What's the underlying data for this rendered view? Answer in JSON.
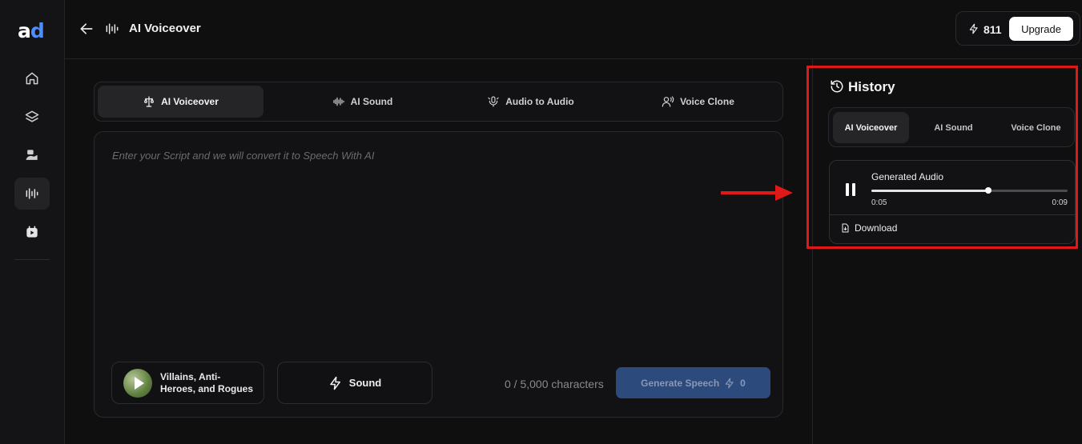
{
  "app": {
    "logo_a": "a",
    "logo_d": "d",
    "accent": "#4c8dff"
  },
  "sidebar": {
    "items": [
      {
        "name": "home",
        "icon": "home-icon",
        "active": false
      },
      {
        "name": "layers",
        "icon": "layers-icon",
        "active": false
      },
      {
        "name": "ai-avatar",
        "icon": "ai-avatar-icon",
        "active": false
      },
      {
        "name": "voice",
        "icon": "waveform-icon",
        "active": true
      },
      {
        "name": "media",
        "icon": "media-icon",
        "active": false
      }
    ]
  },
  "header": {
    "title": "AI Voiceover",
    "credits": "811",
    "upgrade_label": "Upgrade"
  },
  "main": {
    "tabs": [
      {
        "label": "AI Voiceover",
        "icon": "voiceover-icon",
        "active": true
      },
      {
        "label": "AI Sound",
        "icon": "sound-wave-icon",
        "active": false
      },
      {
        "label": "Audio to Audio",
        "icon": "audio-to-audio-icon",
        "active": false
      },
      {
        "label": "Voice Clone",
        "icon": "voice-clone-icon",
        "active": false
      }
    ],
    "script_placeholder": "Enter your Script and we will convert it to Speech With AI",
    "script_value": "",
    "voice_name": "Villains, Anti-Heroes, and Rogues",
    "sound_label": "Sound",
    "char_count": "0 / 5,000 characters",
    "generate_label": "Generate Speech",
    "generate_cost": "0"
  },
  "history": {
    "title": "History",
    "tabs": [
      {
        "label": "AI Voiceover",
        "active": true
      },
      {
        "label": "AI Sound",
        "active": false
      },
      {
        "label": "Voice Clone",
        "active": false
      }
    ],
    "items": [
      {
        "title": "Generated Audio",
        "current_time": "0:05",
        "total_time": "0:09",
        "progress": 0.595,
        "playing": true,
        "download_label": "Download"
      }
    ]
  },
  "annotation": {
    "highlight_color": "#e01818"
  }
}
